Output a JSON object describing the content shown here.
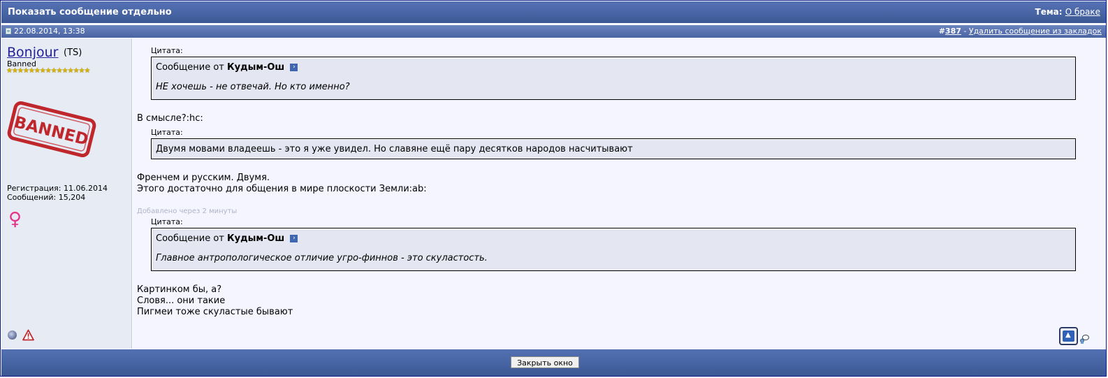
{
  "header": {
    "title": "Показать сообщение отдельно",
    "theme_label": "Тема:",
    "theme_link": "О браке"
  },
  "post_bar": {
    "date": "22.08.2014, 13:38",
    "post_number_prefix": "#",
    "post_number": "387",
    "separator": "-",
    "remove_bookmark": "Удалить сообщение из закладок"
  },
  "author": {
    "username": "Bonjour",
    "ts_badge": "(TS)",
    "rank": "Banned",
    "stars": "★★★★★★★★★★★★★★★",
    "stamp_text": "BANNED",
    "registration": "Регистрация: 11.06.2014",
    "posts": "Сообщений: 15,204",
    "gender_symbol": "♀"
  },
  "post": {
    "quotes": [
      {
        "label": "Цитата:",
        "from_prefix": "Сообщение от",
        "author": "Кудым-Ош",
        "arrow": "›",
        "text": "НЕ хочешь - не отвечай. Но кто именно?"
      },
      {
        "label": "Цитата:",
        "text": "Двумя мовами владеешь - это я уже увидел. Но славяне ещё пару десятков народов насчитывают"
      },
      {
        "label": "Цитата:",
        "from_prefix": "Сообщение от",
        "author": "Кудым-Ош",
        "arrow": "›",
        "text": "Главное антропологическое отличие угро-финнов - это скуластость."
      }
    ],
    "text_1": "В смысле?:hc:",
    "text_2_line1": "Френчем и русским. Двумя.",
    "text_2_line2": "Этого достаточно для общения в мире плоскости Земли:ab:",
    "added_note": "Добавлено через 2 минуты",
    "text_3_line1": "Картинком бы, а?",
    "text_3_line2": "Словя... они такие",
    "text_3_line3": "Пигмеи тоже скуластые бывают",
    "up_arrow": "▲"
  },
  "footer": {
    "close_label": "Закрыть окно"
  },
  "colors": {
    "header_bg": "#3b5894",
    "sidebar_bg": "#e7ebf4",
    "post_bg": "#f5f5ff",
    "quote_bg": "#e4e6f1",
    "username": "#22229c",
    "stamp_red": "#c0272d",
    "gender": "#e6338a"
  }
}
